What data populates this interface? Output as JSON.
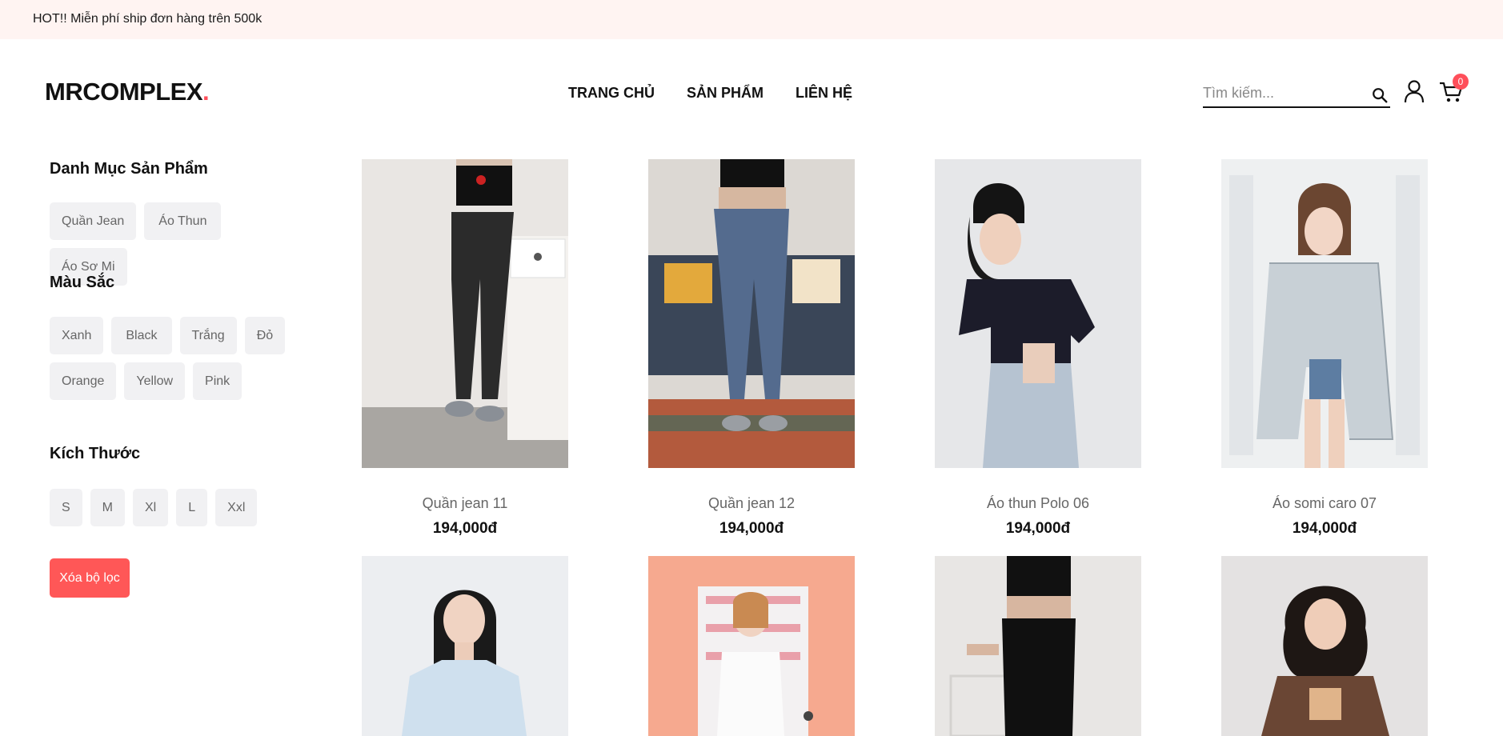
{
  "topbar": {
    "message": "HOT!! Miễn phí ship đơn hàng trên 500k"
  },
  "header": {
    "logo": "MRCOMPLEX",
    "logo_dot": ".",
    "nav": [
      "TRANG CHỦ",
      "SẢN PHẨM",
      "LIÊN HỆ"
    ],
    "search_placeholder": "Tìm kiếm...",
    "cart_count": "0",
    "icons": {
      "search": "search-icon",
      "user": "user-icon",
      "cart": "cart-icon"
    }
  },
  "sidebar": {
    "category_title": "Danh Mục Sản Phẩm",
    "categories": [
      "Quần Jean",
      "Áo Thun",
      "Áo Sơ Mi"
    ],
    "color_title": "Màu Sắc",
    "colors": [
      "Xanh",
      "Black",
      "Trắng",
      "Đỏ",
      "Orange",
      "Yellow",
      "Pink"
    ],
    "size_title": "Kích Thước",
    "sizes": [
      "S",
      "M",
      "Xl",
      "L",
      "Xxl"
    ],
    "clear_label": "Xóa bộ lọc"
  },
  "products": [
    {
      "name": "Quần jean 11",
      "price": "194,000đ"
    },
    {
      "name": "Quần jean 12",
      "price": "194,000đ"
    },
    {
      "name": "Áo thun Polo 06",
      "price": "194,000đ"
    },
    {
      "name": "Áo somi caro 07",
      "price": "194,000đ"
    }
  ],
  "theme": {
    "accent": "#ff4f5a",
    "topbar_bg": "#fff4f2",
    "chip_bg": "#f1f1f3"
  }
}
